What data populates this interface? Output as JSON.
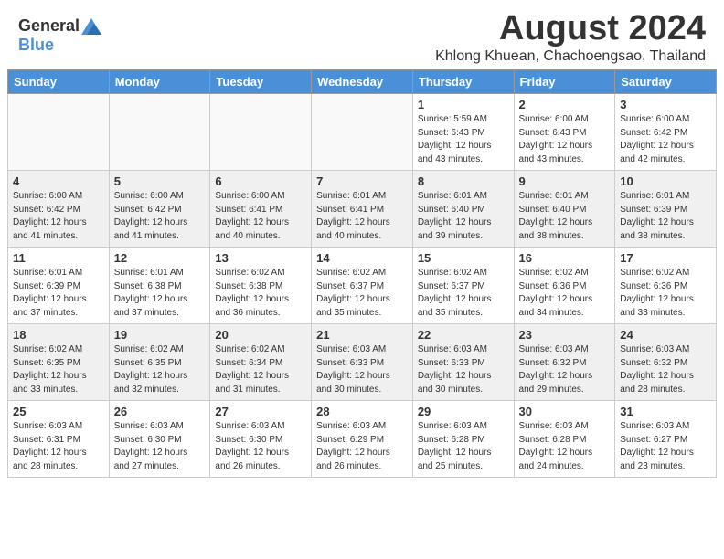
{
  "header": {
    "logo": {
      "general": "General",
      "blue": "Blue"
    },
    "title": "August 2024",
    "subtitle": "Khlong Khuean, Chachoengsao, Thailand"
  },
  "columns": [
    "Sunday",
    "Monday",
    "Tuesday",
    "Wednesday",
    "Thursday",
    "Friday",
    "Saturday"
  ],
  "weeks": [
    {
      "days": [
        {
          "num": "",
          "empty": true
        },
        {
          "num": "",
          "empty": true
        },
        {
          "num": "",
          "empty": true
        },
        {
          "num": "",
          "empty": true
        },
        {
          "num": "1",
          "rise": "5:59 AM",
          "set": "6:43 PM",
          "hours": "12 hours and 43 minutes."
        },
        {
          "num": "2",
          "rise": "6:00 AM",
          "set": "6:43 PM",
          "hours": "12 hours and 43 minutes."
        },
        {
          "num": "3",
          "rise": "6:00 AM",
          "set": "6:42 PM",
          "hours": "12 hours and 42 minutes."
        }
      ]
    },
    {
      "days": [
        {
          "num": "4",
          "rise": "6:00 AM",
          "set": "6:42 PM",
          "hours": "12 hours and 41 minutes."
        },
        {
          "num": "5",
          "rise": "6:00 AM",
          "set": "6:42 PM",
          "hours": "12 hours and 41 minutes."
        },
        {
          "num": "6",
          "rise": "6:00 AM",
          "set": "6:41 PM",
          "hours": "12 hours and 40 minutes."
        },
        {
          "num": "7",
          "rise": "6:01 AM",
          "set": "6:41 PM",
          "hours": "12 hours and 40 minutes."
        },
        {
          "num": "8",
          "rise": "6:01 AM",
          "set": "6:40 PM",
          "hours": "12 hours and 39 minutes."
        },
        {
          "num": "9",
          "rise": "6:01 AM",
          "set": "6:40 PM",
          "hours": "12 hours and 38 minutes."
        },
        {
          "num": "10",
          "rise": "6:01 AM",
          "set": "6:39 PM",
          "hours": "12 hours and 38 minutes."
        }
      ]
    },
    {
      "days": [
        {
          "num": "11",
          "rise": "6:01 AM",
          "set": "6:39 PM",
          "hours": "12 hours and 37 minutes."
        },
        {
          "num": "12",
          "rise": "6:01 AM",
          "set": "6:38 PM",
          "hours": "12 hours and 37 minutes."
        },
        {
          "num": "13",
          "rise": "6:02 AM",
          "set": "6:38 PM",
          "hours": "12 hours and 36 minutes."
        },
        {
          "num": "14",
          "rise": "6:02 AM",
          "set": "6:37 PM",
          "hours": "12 hours and 35 minutes."
        },
        {
          "num": "15",
          "rise": "6:02 AM",
          "set": "6:37 PM",
          "hours": "12 hours and 35 minutes."
        },
        {
          "num": "16",
          "rise": "6:02 AM",
          "set": "6:36 PM",
          "hours": "12 hours and 34 minutes."
        },
        {
          "num": "17",
          "rise": "6:02 AM",
          "set": "6:36 PM",
          "hours": "12 hours and 33 minutes."
        }
      ]
    },
    {
      "days": [
        {
          "num": "18",
          "rise": "6:02 AM",
          "set": "6:35 PM",
          "hours": "12 hours and 33 minutes."
        },
        {
          "num": "19",
          "rise": "6:02 AM",
          "set": "6:35 PM",
          "hours": "12 hours and 32 minutes."
        },
        {
          "num": "20",
          "rise": "6:02 AM",
          "set": "6:34 PM",
          "hours": "12 hours and 31 minutes."
        },
        {
          "num": "21",
          "rise": "6:03 AM",
          "set": "6:33 PM",
          "hours": "12 hours and 30 minutes."
        },
        {
          "num": "22",
          "rise": "6:03 AM",
          "set": "6:33 PM",
          "hours": "12 hours and 30 minutes."
        },
        {
          "num": "23",
          "rise": "6:03 AM",
          "set": "6:32 PM",
          "hours": "12 hours and 29 minutes."
        },
        {
          "num": "24",
          "rise": "6:03 AM",
          "set": "6:32 PM",
          "hours": "12 hours and 28 minutes."
        }
      ]
    },
    {
      "days": [
        {
          "num": "25",
          "rise": "6:03 AM",
          "set": "6:31 PM",
          "hours": "12 hours and 28 minutes."
        },
        {
          "num": "26",
          "rise": "6:03 AM",
          "set": "6:30 PM",
          "hours": "12 hours and 27 minutes."
        },
        {
          "num": "27",
          "rise": "6:03 AM",
          "set": "6:30 PM",
          "hours": "12 hours and 26 minutes."
        },
        {
          "num": "28",
          "rise": "6:03 AM",
          "set": "6:29 PM",
          "hours": "12 hours and 26 minutes."
        },
        {
          "num": "29",
          "rise": "6:03 AM",
          "set": "6:28 PM",
          "hours": "12 hours and 25 minutes."
        },
        {
          "num": "30",
          "rise": "6:03 AM",
          "set": "6:28 PM",
          "hours": "12 hours and 24 minutes."
        },
        {
          "num": "31",
          "rise": "6:03 AM",
          "set": "6:27 PM",
          "hours": "12 hours and 23 minutes."
        }
      ]
    }
  ]
}
